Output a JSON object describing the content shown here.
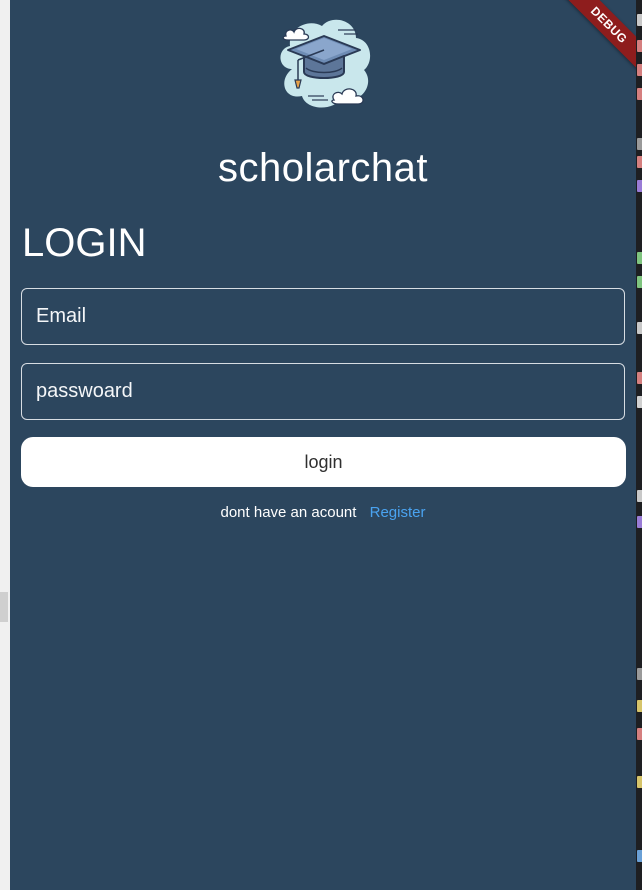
{
  "app": {
    "title": "scholarchat",
    "logo_icon": "graduation-cap-cloud-icon"
  },
  "debug_banner": "DEBUG",
  "login": {
    "heading": "LOGIN",
    "email_placeholder": "Email",
    "password_placeholder": "passwoard",
    "button_label": "login",
    "register_prompt": "dont have an acount",
    "register_link": "Register"
  },
  "colors": {
    "background": "#2c465e",
    "button_bg": "#ffffff",
    "link": "#4aa3f0",
    "debug_banner": "#8e1d1d"
  }
}
